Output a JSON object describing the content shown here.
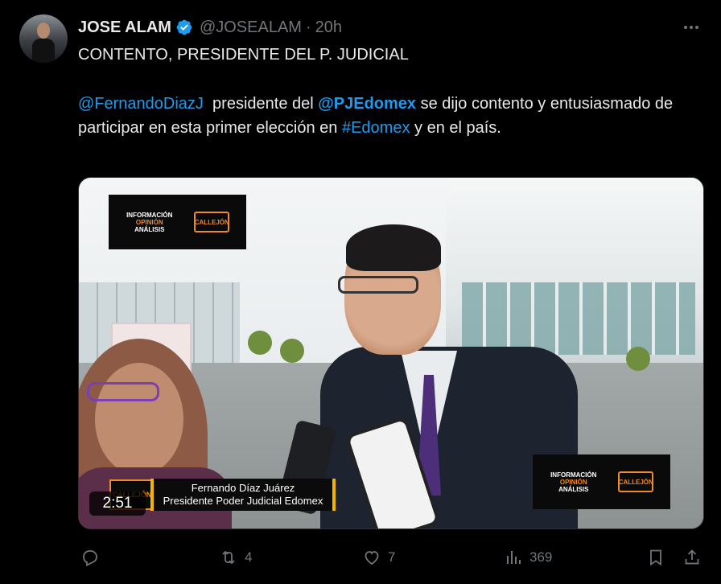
{
  "tweet": {
    "author_name": "JOSE ALAM",
    "handle": "@JOSEALAM",
    "separator": "·",
    "time": "20h",
    "headline": "CONTENTO,  PRESIDENTE DEL P. JUDICIAL",
    "body": {
      "mention1": "@FernandoDiazJ",
      "text1": "  presidente del ",
      "mention2": "@PJEdomex",
      "text2": " se dijo contento y entusiasmado de participar en esta primer elección en ",
      "hashtag": "#Edomex",
      "text3": " y en el país."
    }
  },
  "video": {
    "duration": "2:51",
    "lower_third_name": "Fernando Díaz Juárez",
    "lower_third_title": "Presidente Poder Judicial Edomex",
    "logo_line1": "INFORMACIÓN",
    "logo_line2": "OPINIÓN",
    "logo_line3": "ANÁLISIS",
    "brand": "CALLEJÓN"
  },
  "actions": {
    "reposts": "4",
    "likes": "7",
    "views": "369"
  },
  "colors": {
    "background": "#000000",
    "accent": "#1d9bf0",
    "muted": "#71767b",
    "text": "#e7e9ea"
  },
  "icons": [
    "verified-badge-icon",
    "more-icon",
    "reply-icon",
    "repost-icon",
    "like-icon",
    "views-icon",
    "bookmark-icon",
    "share-icon"
  ]
}
